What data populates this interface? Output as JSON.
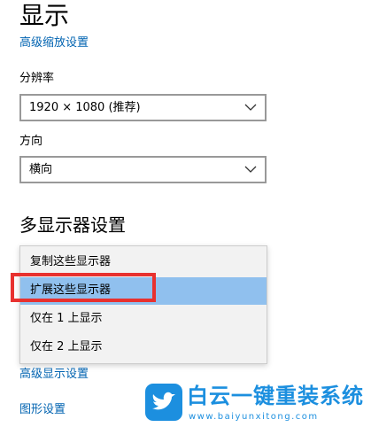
{
  "page": {
    "title": "显示",
    "advanced_scaling_link": "高级缩放设置"
  },
  "resolution": {
    "label": "分辨率",
    "value": "1920 × 1080 (推荐)"
  },
  "orientation": {
    "label": "方向",
    "value": "横向"
  },
  "multi_display": {
    "title": "多显示器设置",
    "options": [
      {
        "label": "复制这些显示器",
        "selected": false
      },
      {
        "label": "扩展这些显示器",
        "selected": true
      },
      {
        "label": "仅在 1 上显示",
        "selected": false
      },
      {
        "label": "仅在 2 上显示",
        "selected": false
      }
    ]
  },
  "links": {
    "advanced_display": "高级显示设置",
    "graphics": "图形设置"
  },
  "watermark": {
    "title": "白云一键重装系统",
    "url": "www.baiyunxitong.com"
  },
  "colors": {
    "link": "#0063b1",
    "selected_option": "#90c0ee",
    "highlight_border": "#e8312f",
    "watermark": "#1c8fdf"
  }
}
